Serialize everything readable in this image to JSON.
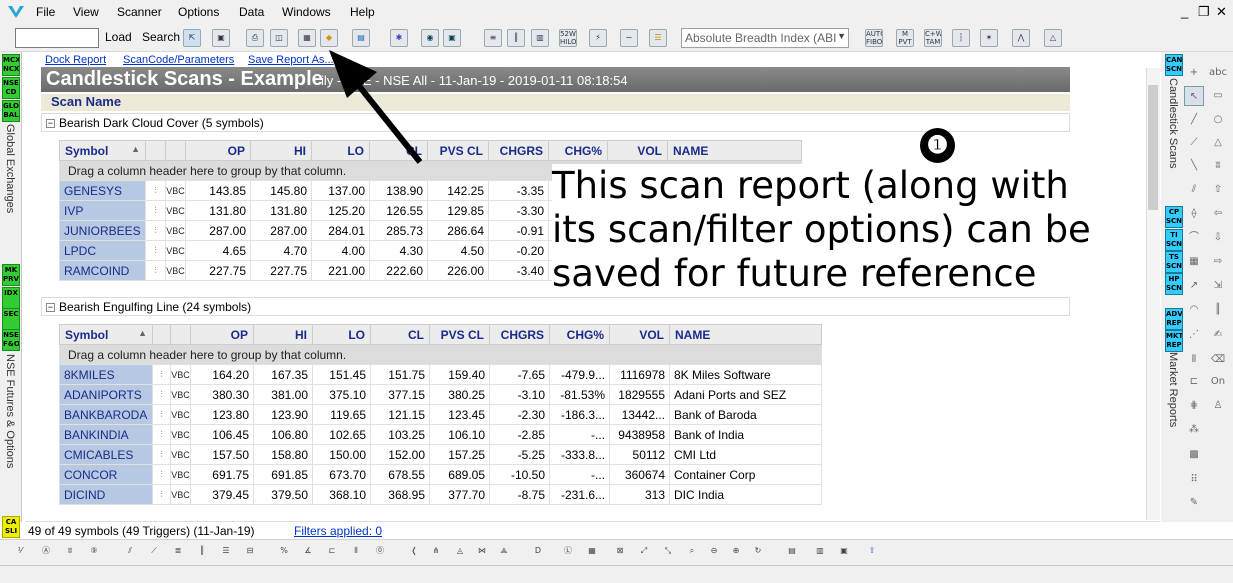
{
  "menu": {
    "items": [
      "File",
      "View",
      "Scanner",
      "Options",
      "Data",
      "Windows",
      "Help"
    ],
    "window_controls": [
      "_",
      "❐",
      "✕"
    ]
  },
  "toolbar": {
    "symbol_value": "",
    "load_label": "Load",
    "search_label": "Search",
    "indicator_selected": "Absolute Breadth Index (ABI",
    "icon_labels": [
      "52W HILO",
      "M PVT",
      "C+W TAM",
      "AUTO FIBO",
      "ADV DECL"
    ]
  },
  "top_links": {
    "dock": "Dock Report",
    "scancode": "ScanCode/Parameters",
    "save": "Save Report As..."
  },
  "report": {
    "title": "Candlestick Scans - Example",
    "subtitle": "ily - NSE - NSE All - 11-Jan-19 - 2019-01-11 08:18:54",
    "scan_name_header": "Scan Name",
    "group_by_hint": "Drag a column header here to group by that column."
  },
  "columns": [
    "Symbol",
    "OP",
    "HI",
    "LO",
    "CL",
    "PVS CL",
    "CHGRS",
    "CHG%",
    "VOL",
    "NAME"
  ],
  "groups": [
    {
      "name": "Bearish Dark Cloud Cover (5 symbols)",
      "rows": [
        {
          "sym": "GENESYS",
          "op": "143.85",
          "hi": "145.80",
          "lo": "137.00",
          "cl": "138.90",
          "pcl": "142.25",
          "chg": "-3.35",
          "pct": "",
          "vol": "",
          "name": ""
        },
        {
          "sym": "IVP",
          "op": "131.80",
          "hi": "131.80",
          "lo": "125.20",
          "cl": "126.55",
          "pcl": "129.85",
          "chg": "-3.30",
          "pct": "",
          "vol": "",
          "name": ""
        },
        {
          "sym": "JUNIORBEES",
          "op": "287.00",
          "hi": "287.00",
          "lo": "284.01",
          "cl": "285.73",
          "pcl": "286.64",
          "chg": "-0.91",
          "pct": "",
          "vol": "",
          "name": ""
        },
        {
          "sym": "LPDC",
          "op": "4.65",
          "hi": "4.70",
          "lo": "4.00",
          "cl": "4.30",
          "pcl": "4.50",
          "chg": "-0.20",
          "pct": "",
          "vol": "",
          "name": ""
        },
        {
          "sym": "RAMCOIND",
          "op": "227.75",
          "hi": "227.75",
          "lo": "221.00",
          "cl": "222.60",
          "pcl": "226.00",
          "chg": "-3.40",
          "pct": "",
          "vol": "",
          "name": ""
        }
      ]
    },
    {
      "name": "Bearish Engulfing Line (24 symbols)",
      "rows": [
        {
          "sym": "8KMILES",
          "op": "164.20",
          "hi": "167.35",
          "lo": "151.45",
          "cl": "151.75",
          "pcl": "159.40",
          "chg": "-7.65",
          "pct": "-479.9...",
          "vol": "1116978",
          "name": "8K Miles Software"
        },
        {
          "sym": "ADANIPORTS",
          "op": "380.30",
          "hi": "381.00",
          "lo": "375.10",
          "cl": "377.15",
          "pcl": "380.25",
          "chg": "-3.10",
          "pct": "-81.53%",
          "vol": "1829555",
          "name": "Adani Ports and SEZ"
        },
        {
          "sym": "BANKBARODA",
          "op": "123.80",
          "hi": "123.90",
          "lo": "119.65",
          "cl": "121.15",
          "pcl": "123.45",
          "chg": "-2.30",
          "pct": "-186.3...",
          "vol": "13442...",
          "name": "Bank of Baroda"
        },
        {
          "sym": "BANKINDIA",
          "op": "106.45",
          "hi": "106.80",
          "lo": "102.65",
          "cl": "103.25",
          "pcl": "106.10",
          "chg": "-2.85",
          "pct": "-...",
          "vol": "9438958",
          "name": "Bank of India"
        },
        {
          "sym": "CMICABLES",
          "op": "157.50",
          "hi": "158.80",
          "lo": "150.00",
          "cl": "152.00",
          "pcl": "157.25",
          "chg": "-5.25",
          "pct": "-333.8...",
          "vol": "50112",
          "name": "CMI Ltd"
        },
        {
          "sym": "CONCOR",
          "op": "691.75",
          "hi": "691.85",
          "lo": "673.70",
          "cl": "678.55",
          "pcl": "689.05",
          "chg": "-10.50",
          "pct": "-...",
          "vol": "360674",
          "name": "Container Corp"
        },
        {
          "sym": "DICIND",
          "op": "379.45",
          "hi": "379.50",
          "lo": "368.10",
          "cl": "368.95",
          "pcl": "377.70",
          "chg": "-8.75",
          "pct": "-231.6...",
          "vol": "313",
          "name": "DIC India"
        }
      ]
    }
  ],
  "row_icon_text": "VBC",
  "status": {
    "count": "49 of 49 symbols (49 Triggers) (11-Jan-19)",
    "filters": "Filters applied: 0"
  },
  "left_panel": {
    "badges": [
      "MCX NCX",
      "NSE CD",
      "GLO BAL",
      "MK PRV",
      "IDX",
      "SEC",
      "NSE F&O",
      "CA SLI"
    ],
    "label_1": "Global Exchanges",
    "label_2": "NSE Futures & Options"
  },
  "right_panel": {
    "badges": [
      "CAN SCN",
      "CP SCN",
      "TI SCN",
      "TS SCN",
      "HP SCN",
      "ADV REP",
      "MKT REP"
    ],
    "label_1": "Candlestick Scans",
    "label_2": "Market Reports",
    "tools": [
      "abc",
      "On"
    ]
  },
  "annotation": {
    "marker": "❶",
    "lines": [
      "This scan report (along with",
      "its scan/filter options) can be",
      "saved for future reference"
    ]
  },
  "colors": {
    "symbol_cell": "#b7c9e2",
    "header_text": "#1a2b8a",
    "title_bar": "#7a7a7a",
    "badge_green": "#33cc33",
    "badge_blue": "#33ccff"
  }
}
